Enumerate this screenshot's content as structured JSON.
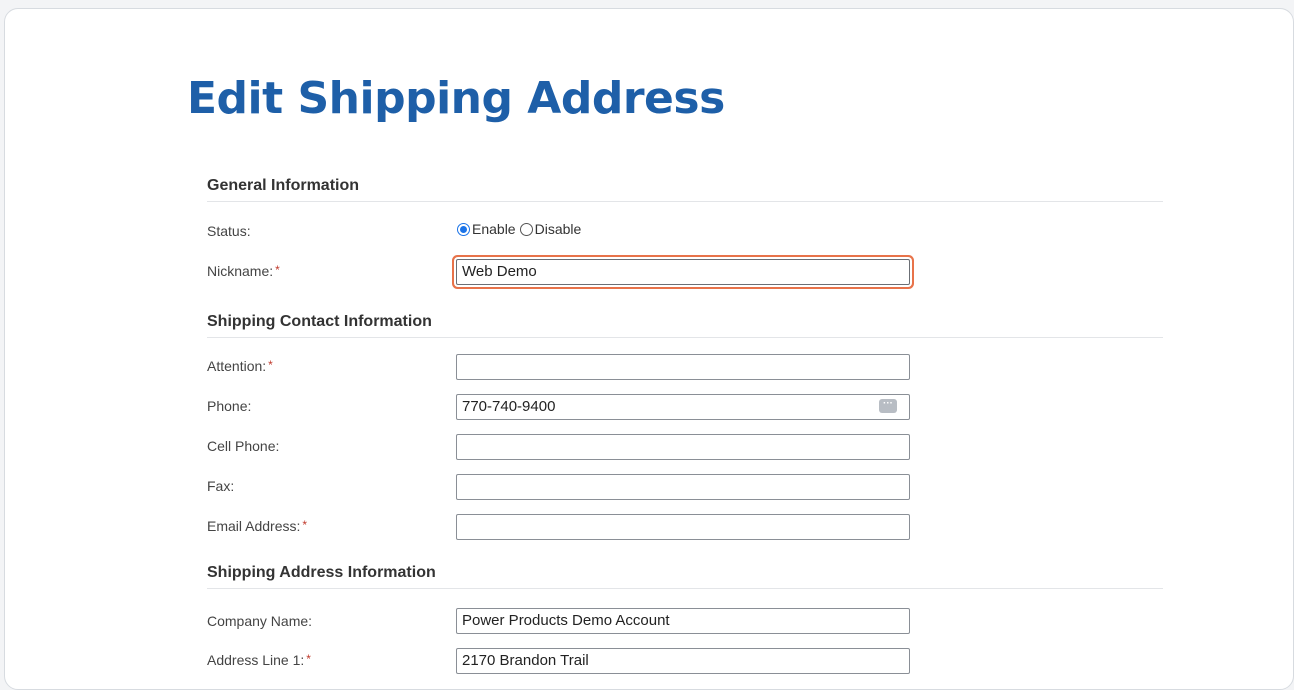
{
  "page": {
    "title": "Edit Shipping Address"
  },
  "general": {
    "heading": "General Information",
    "status_label": "Status:",
    "status_options": [
      "Enable",
      "Disable"
    ],
    "status_selected": "Enable",
    "nickname_label": "Nickname:",
    "nickname_value": "Web Demo"
  },
  "contact": {
    "heading": "Shipping Contact Information",
    "attention_label": "Attention:",
    "attention_value": "",
    "phone_label": "Phone:",
    "phone_value": "770-740-9400",
    "phone_button": "···",
    "cell_label": "Cell Phone:",
    "cell_value": "",
    "fax_label": "Fax:",
    "fax_value": "",
    "email_label": "Email Address:",
    "email_value": ""
  },
  "address": {
    "heading": "Shipping Address Information",
    "company_label": "Company Name:",
    "company_value": "Power Products Demo Account",
    "line1_label": "Address Line 1:",
    "line1_value": "2170 Brandon Trail"
  },
  "required_marker": "*",
  "colors": {
    "title": "#1e5fa8",
    "focus_ring": "#e8734a",
    "required": "#c0392b",
    "radio_selected": "#1a73e8"
  }
}
